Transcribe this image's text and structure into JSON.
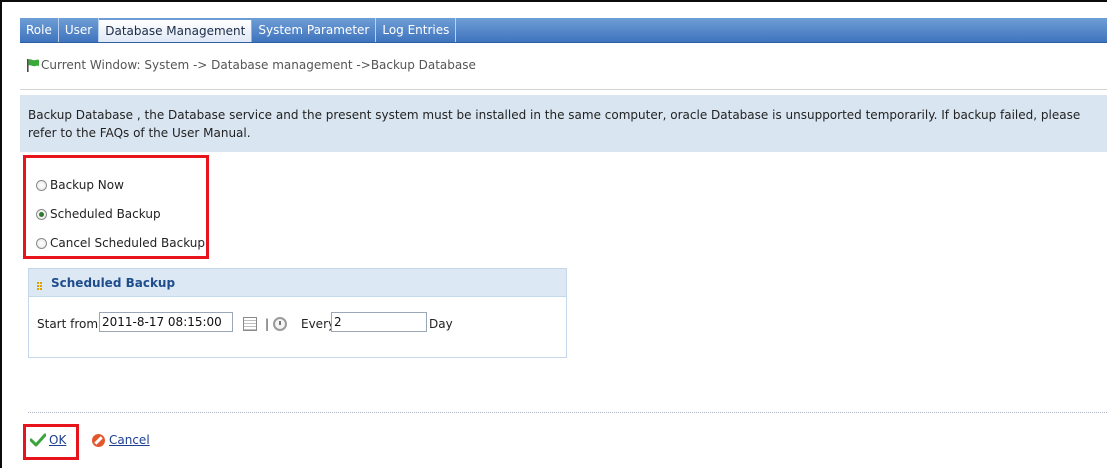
{
  "tabs": [
    {
      "label": "Role",
      "active": false
    },
    {
      "label": "User",
      "active": false
    },
    {
      "label": "Database Management",
      "active": true
    },
    {
      "label": "System Parameter",
      "active": false
    },
    {
      "label": "Log Entries",
      "active": false
    }
  ],
  "breadcrumb": {
    "icon": "green-flag-icon",
    "text": "Current Window: System -> Database management ->Backup Database"
  },
  "notice": {
    "text": "Backup Database , the Database service and the present system must be installed in the same computer, oracle Database is unsupported temporarily. If backup failed, please refer to the FAQs of the User Manual."
  },
  "backup_options": {
    "items": [
      {
        "label": "Backup Now",
        "checked": false
      },
      {
        "label": "Scheduled Backup",
        "checked": true
      },
      {
        "label": "Cancel Scheduled Backup",
        "checked": false
      }
    ]
  },
  "scheduled_panel": {
    "title": "Scheduled Backup",
    "start_label": "Start from",
    "start_value": "2011-8-17 08:15:00",
    "separator": "|",
    "every_label": "Every",
    "every_value": "2",
    "unit_label": "Day"
  },
  "actions": {
    "ok_label": "OK",
    "cancel_label": "Cancel"
  },
  "colors": {
    "tab_bar": "#4a7fc4",
    "notice_bg": "#d9e6f1",
    "highlight": "#e8141c",
    "link": "#1d3f91"
  }
}
